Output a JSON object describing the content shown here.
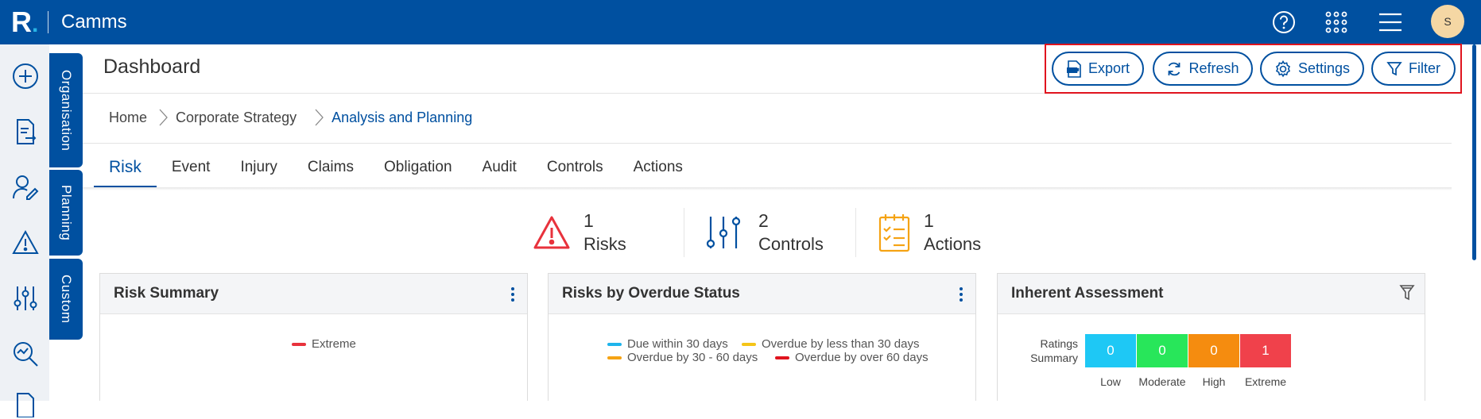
{
  "app": {
    "logo": "R",
    "logo_dot": ".",
    "title": "Camms"
  },
  "topbar": {
    "avatar_initial": "S",
    "icons": [
      "help-icon",
      "apps-grid-icon",
      "hamburger-menu-icon"
    ]
  },
  "left_rail": {
    "icons": [
      "add-icon",
      "document-export-icon",
      "user-edit-icon",
      "warning-icon",
      "sliders-icon",
      "analytics-search-icon",
      "document-icon"
    ]
  },
  "vertical_tabs": [
    "Organisation",
    "Planning",
    "Custom"
  ],
  "header": {
    "title": "Dashboard",
    "actions": {
      "export": "Export",
      "refresh": "Refresh",
      "settings": "Settings",
      "filter": "Filter"
    }
  },
  "breadcrumb": [
    "Home",
    "Corporate Strategy",
    "Analysis and Planning"
  ],
  "tabs": [
    "Risk",
    "Event",
    "Injury",
    "Claims",
    "Obligation",
    "Audit",
    "Controls",
    "Actions"
  ],
  "kpis": [
    {
      "value": "1",
      "label": "Risks"
    },
    {
      "value": "2",
      "label": "Controls"
    },
    {
      "value": "1",
      "label": "Actions"
    }
  ],
  "cards": {
    "risk_summary": {
      "title": "Risk Summary",
      "legend": [
        {
          "label": "Extreme",
          "color": "#e8323c"
        }
      ]
    },
    "overdue_status": {
      "title": "Risks by Overdue Status",
      "legend": [
        {
          "label": "Due within 30 days",
          "color": "#1eb4ec"
        },
        {
          "label": "Overdue by less than 30 days",
          "color": "#f5c518"
        },
        {
          "label": "Overdue by 30 - 60 days",
          "color": "#f5a314"
        },
        {
          "label": "Overdue by over 60 days",
          "color": "#e0141e"
        }
      ]
    },
    "inherent_assessment": {
      "title": "Inherent Assessment",
      "ratings_label_line1": "Ratings",
      "ratings_label_line2": "Summary",
      "ratings": [
        {
          "label": "Low",
          "value": "0",
          "color": "#1ec8f5"
        },
        {
          "label": "Moderate",
          "value": "0",
          "color": "#28e65a"
        },
        {
          "label": "High",
          "value": "0",
          "color": "#f58c0f"
        },
        {
          "label": "Extreme",
          "value": "1",
          "color": "#f0414b"
        }
      ]
    }
  },
  "colors": {
    "brand": "#0050a0",
    "highlight_box": "#e0141e"
  }
}
